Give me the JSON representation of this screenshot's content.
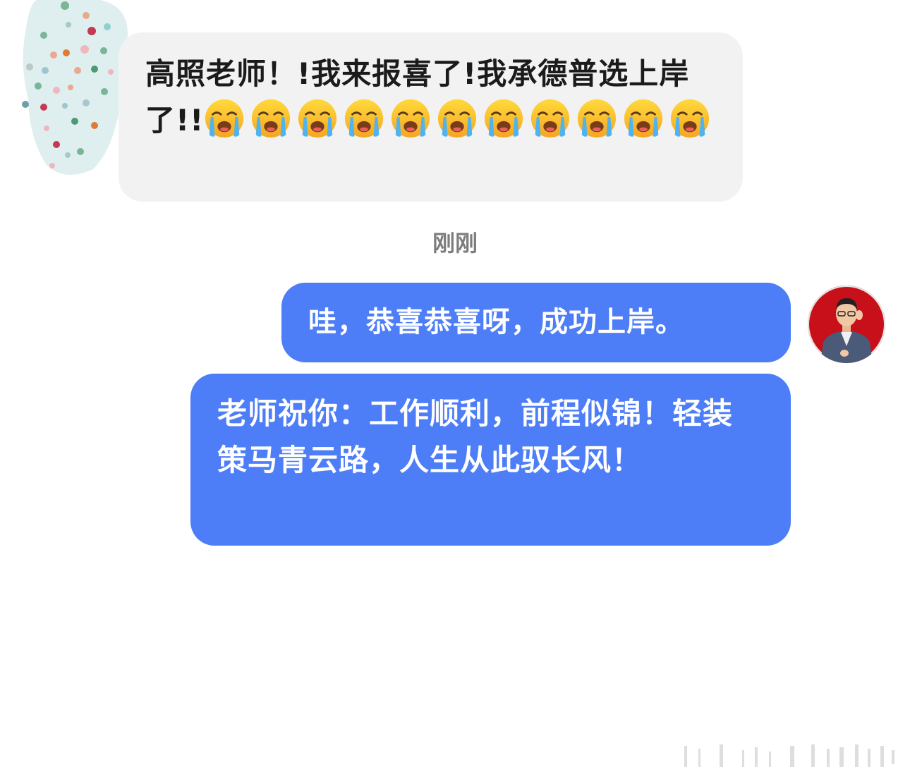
{
  "incoming_message": {
    "text": "高照老师！!我来报喜了!我承德普选上岸了!!",
    "emoji_count": 11,
    "emoji_name": "loudly-crying-face-icon"
  },
  "timestamp": "刚刚",
  "outgoing_messages": [
    {
      "text": "哇，恭喜恭喜呀，成功上岸。"
    },
    {
      "text": "老师祝你：工作顺利，前程似锦！轻装策马青云路，人生从此驭长风！"
    }
  ],
  "colors": {
    "incoming_bubble": "#f2f2f2",
    "outgoing_bubble": "#4d7ef7",
    "timestamp_text": "#7d7d7d",
    "avatar_bg": "#c8101a"
  }
}
